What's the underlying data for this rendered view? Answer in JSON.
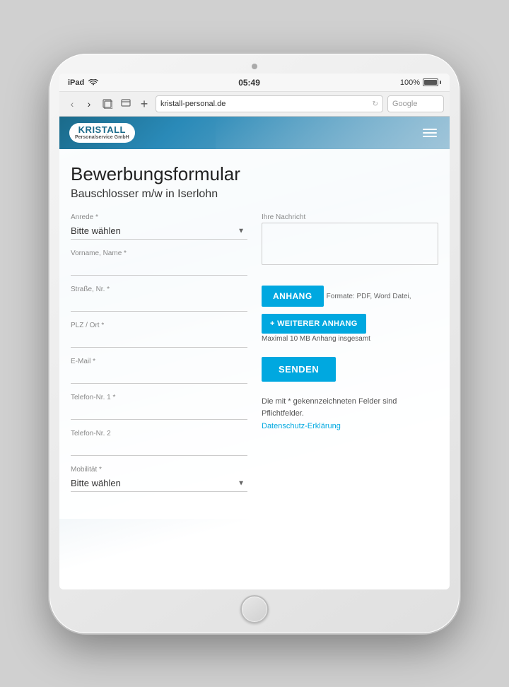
{
  "device": {
    "camera_aria": "iPad camera",
    "home_btn_aria": "Home button"
  },
  "status_bar": {
    "device_label": "iPad",
    "time": "05:49",
    "battery": "100%"
  },
  "browser": {
    "url": "kristall-personal.de",
    "search_placeholder": "Google",
    "back_label": "‹",
    "forward_label": "›",
    "tab_label": "⧉",
    "bookmark_label": "⊟",
    "add_label": "+"
  },
  "header": {
    "logo_brand": "KRISTALL",
    "logo_sub": "Personalservice GmbH",
    "menu_aria": "hamburger menu"
  },
  "form": {
    "title": "Bewerbungsformular",
    "subtitle": "Bauschlosser m/w in Iserlohn",
    "anrede_label": "Anrede *",
    "anrede_placeholder": "Bitte wählen",
    "nachricht_label": "Ihre Nachricht",
    "vorname_label": "Vorname, Name *",
    "strasse_label": "Straße, Nr. *",
    "plz_label": "PLZ / Ort *",
    "email_label": "E-Mail *",
    "telefon1_label": "Telefon-Nr. 1 *",
    "telefon2_label": "Telefon-Nr. 2",
    "mobilitaet_label": "Mobilität *",
    "mobilitaet_placeholder": "Bitte wählen",
    "anhang_btn": "ANHANG",
    "anhang_hint": "Formate: PDF, Word Datei,",
    "weiterer_btn": "+ WEITERER ANHANG",
    "max_hint": "Maximal 10 MB Anhang insgesamt",
    "senden_btn": "SENDEN",
    "required_note": "Die mit * gekennzeichneten Felder sind Pflichtfelder.",
    "datenschutz_label": "Datenschutz-Erklärung",
    "datenschutz_href": "#"
  }
}
